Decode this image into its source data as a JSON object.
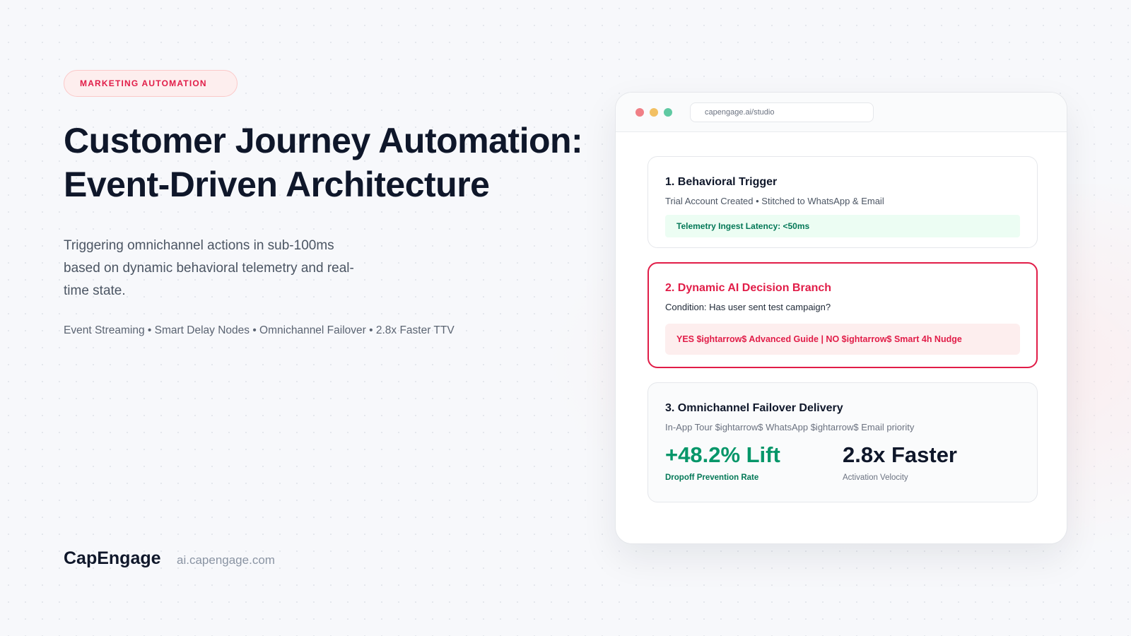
{
  "hero": {
    "badge": "MARKETING AUTOMATION",
    "title_line1": "Customer Journey Automation:",
    "title_line2": "Event-Driven Architecture",
    "subtitle": "Triggering omnichannel actions in sub-100ms based on dynamic behavioral telemetry and real-time state.",
    "features": "Event Streaming • Smart Delay Nodes • Omnichannel Failover • 2.8x Faster TTV"
  },
  "footer": {
    "brand": "CapEngage",
    "url": "ai.capengage.com"
  },
  "window": {
    "url": "capengage.ai/studio",
    "cards": [
      {
        "title": "1. Behavioral Trigger",
        "subtitle": "Trial Account Created • Stitched to WhatsApp & Email",
        "pill": "Telemetry Ingest Latency: <50ms"
      },
      {
        "title": "2. Dynamic AI Decision Branch",
        "subtitle": "Condition: Has user sent test campaign?",
        "pill": "YES $ightarrow$ Advanced Guide | NO $ightarrow$ Smart 4h Nudge"
      },
      {
        "title": "3. Omnichannel Failover Delivery",
        "subtitle": "In-App Tour $ightarrow$ WhatsApp $ightarrow$ Email priority",
        "metrics": [
          {
            "value": "+48.2% Lift",
            "label": "Dropoff Prevention Rate"
          },
          {
            "value": "2.8x Faster",
            "label": "Activation Velocity"
          }
        ]
      }
    ]
  },
  "colors": {
    "accent": "#e11d48",
    "success": "#059669",
    "text": "#0f172a"
  }
}
